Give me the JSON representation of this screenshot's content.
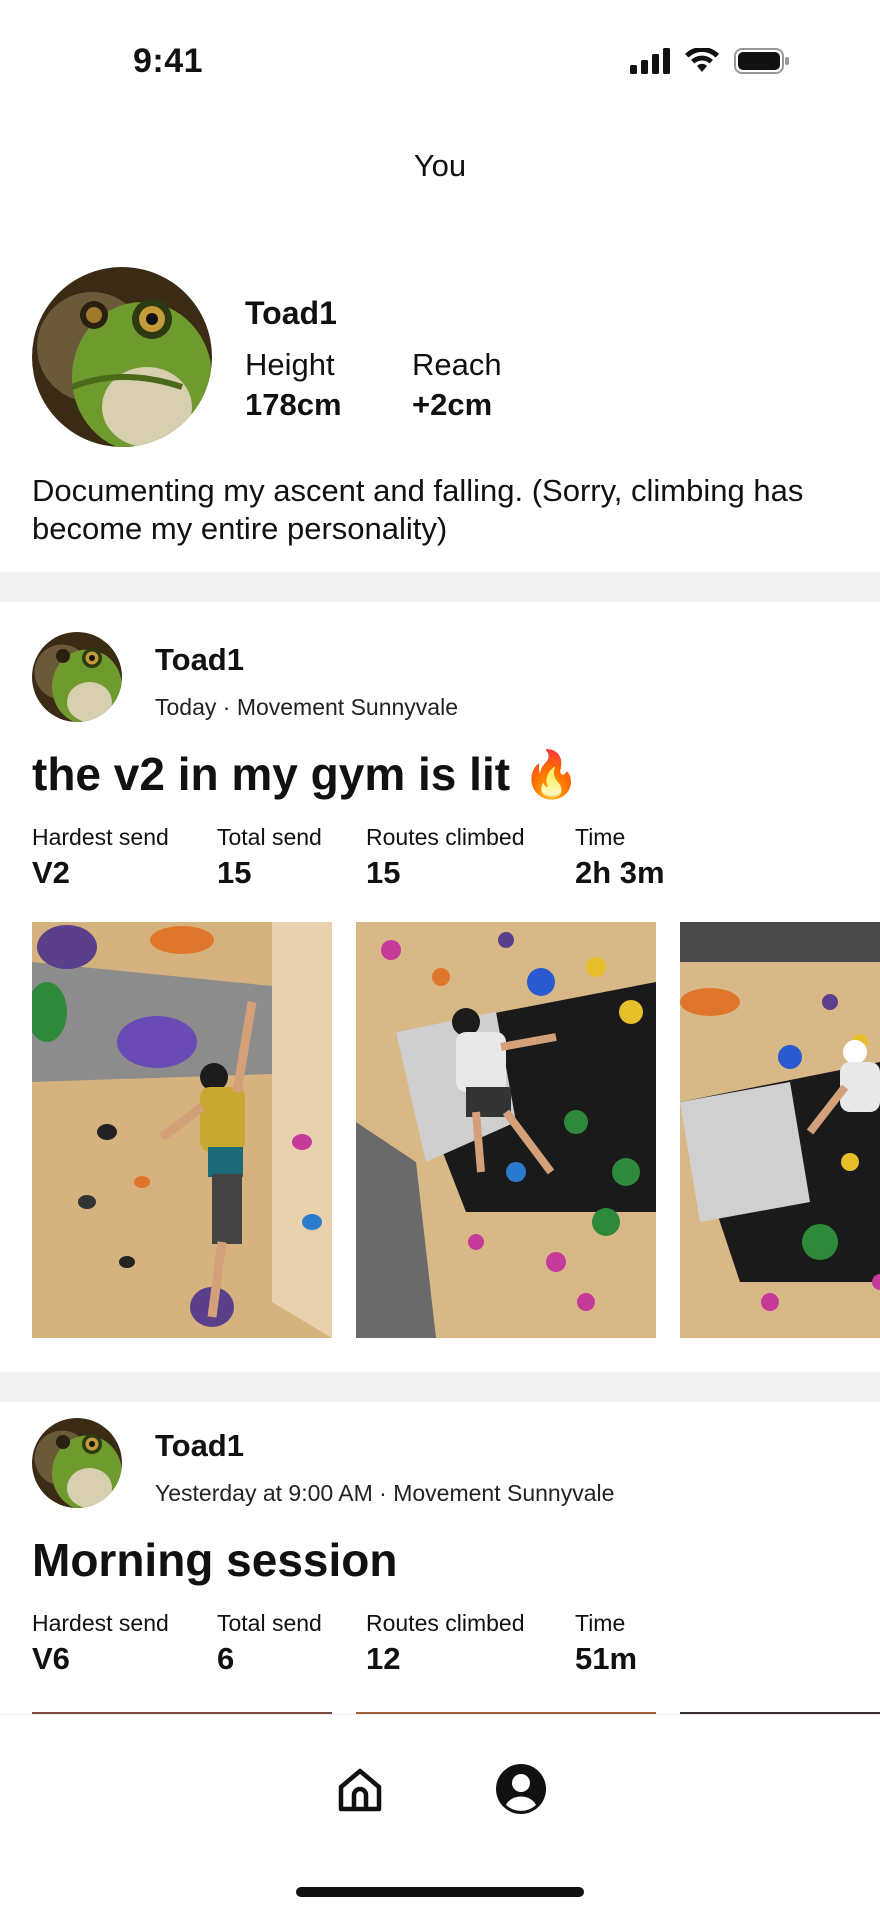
{
  "status_bar": {
    "time": "9:41"
  },
  "header": {
    "title": "You"
  },
  "profile": {
    "name": "Toad1",
    "height_label": "Height",
    "height_value": "178cm",
    "reach_label": "Reach",
    "reach_value": "+2cm",
    "bio": "Documenting my ascent and falling. (Sorry, climbing has become my entire personality)"
  },
  "posts": [
    {
      "author": "Toad1",
      "meta": "Today · Movement Sunnyvale",
      "title": "the v2 in my gym is lit 🔥",
      "stats": [
        {
          "label": "Hardest send",
          "value": "V2"
        },
        {
          "label": "Total send",
          "value": "15"
        },
        {
          "label": "Routes climbed",
          "value": "15"
        },
        {
          "label": "Time",
          "value": "2h 3m"
        }
      ]
    },
    {
      "author": "Toad1",
      "meta": "Yesterday at 9:00 AM · Movement Sunnyvale",
      "title": "Morning session",
      "stats": [
        {
          "label": "Hardest send",
          "value": "V6"
        },
        {
          "label": "Total send",
          "value": "6"
        },
        {
          "label": "Routes climbed",
          "value": "12"
        },
        {
          "label": "Time",
          "value": "51m"
        }
      ]
    }
  ],
  "tab_bar": {
    "tabs": [
      {
        "icon": "home-icon"
      },
      {
        "icon": "profile-icon"
      }
    ]
  },
  "colors": {
    "divider": "#f2f2f2",
    "text": "#111111",
    "wall": "#d9b98c"
  }
}
